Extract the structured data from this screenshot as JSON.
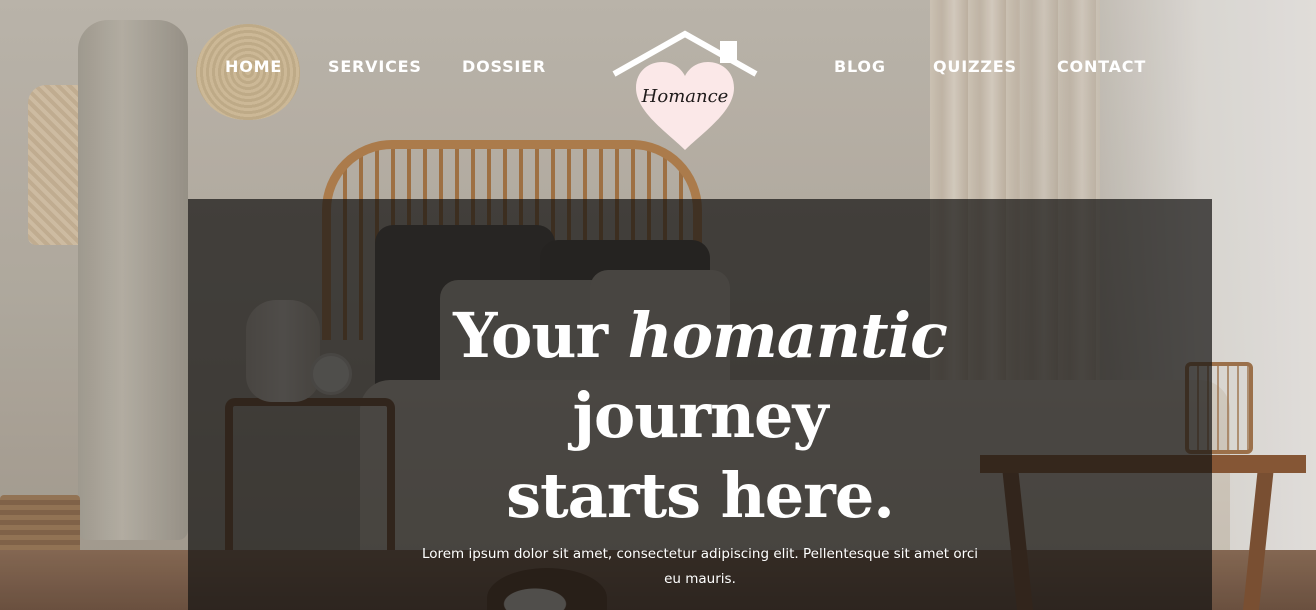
{
  "nav": {
    "left": [
      {
        "label": "HOME"
      },
      {
        "label": "SERVICES"
      },
      {
        "label": "DOSSIER"
      }
    ],
    "right": [
      {
        "label": "BLOG"
      },
      {
        "label": "QUIZZES"
      },
      {
        "label": "CONTACT"
      }
    ]
  },
  "logo": {
    "text": "Homance",
    "icon": "house-heart-icon",
    "heart_color": "#fbe8e8",
    "roof_color": "#ffffff"
  },
  "hero": {
    "title_line1_plain": "Your ",
    "title_line1_emphasis": "homantic",
    "title_line2": "journey",
    "title_line3": "starts here.",
    "subtitle": "Lorem ipsum dolor sit amet, consectetur adipiscing elit. Pellentesque sit amet orci eu mauris.",
    "background_image": "bedroom-photo",
    "overlay_color": "#161513"
  }
}
